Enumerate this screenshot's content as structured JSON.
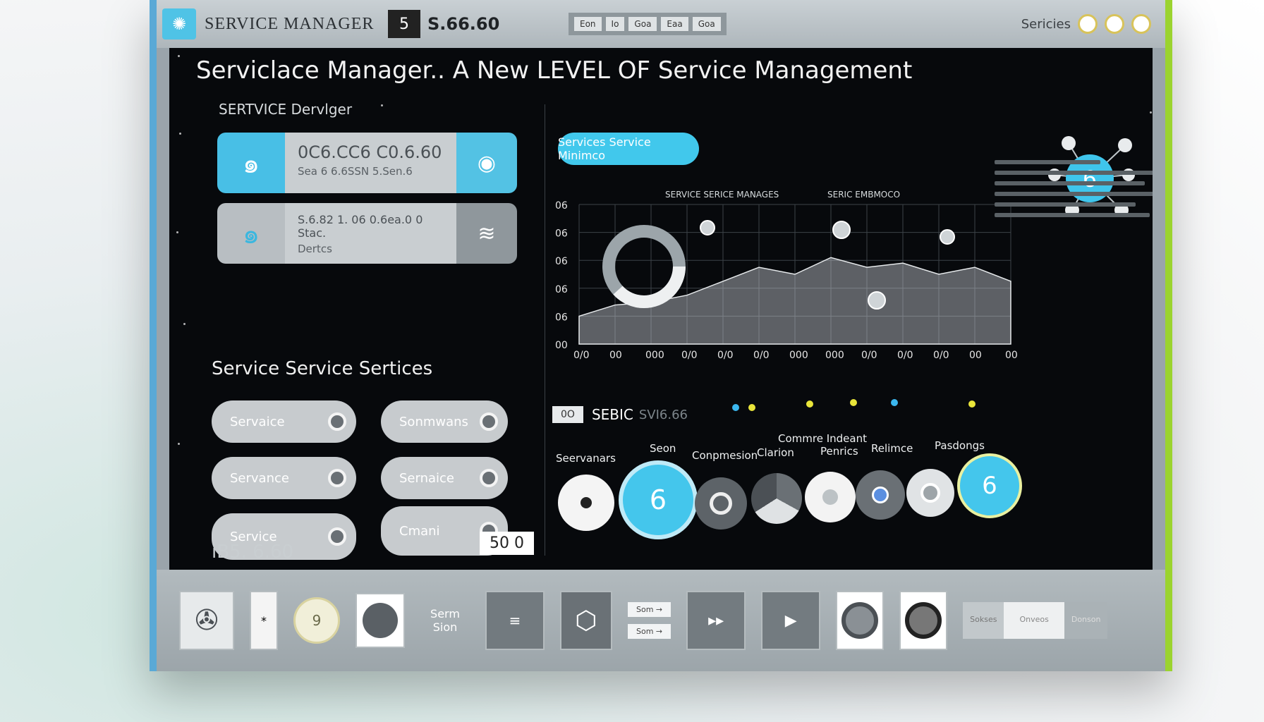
{
  "topbar": {
    "app_title": "SERVICE MANAGER",
    "count": "5",
    "version": "S.66.60",
    "mini_tabs": [
      "Eon",
      "Io",
      "Goa",
      "Eaa",
      "Goa"
    ],
    "right_label": "Sericies"
  },
  "headline": "Serviclace Manager.. A New LEVEL OF Service Management",
  "left_panel": {
    "label": "SERTVICE Dervlger",
    "cards": [
      {
        "main": "0C6.CC6   C0.6.60",
        "sub": "Sea 6   6.6SSN  5.Sen.6"
      },
      {
        "main": "S.6.82  1. 06 0.6ea.0   0 Stac.",
        "sub": "Dertcs"
      }
    ],
    "section_title": "Service Service Sertices",
    "pills": [
      "Servaice",
      "Sonmwans",
      "Servance",
      "Sernaice",
      "Service",
      "Cmani"
    ],
    "mini_count": "50  0",
    "bottom_version": "iB5. 6.60"
  },
  "right_panel": {
    "cta": "Services Service Minimco",
    "chart_title_left": "SERVICE SERICE MANAGES",
    "chart_title_right": "SERIC EMBMOCO",
    "y_ticks": [
      "06",
      "06",
      "06",
      "06",
      "06",
      "00"
    ],
    "x_ticks": [
      "0/0",
      "00",
      "000",
      "0/0",
      "0/0",
      "0/0",
      "000",
      "000",
      "0/0",
      "0/0",
      "0/0",
      "00",
      "00"
    ],
    "service_small": "0O",
    "service_code": "SEBIC",
    "service_code_sub": "SVI6.66",
    "gauge_title": "Commre Indeant",
    "gauges": [
      "Seervanars",
      "Seon",
      "Conpmesion",
      "Clarion",
      "Penrics",
      "Relimce",
      "Pasdongs"
    ],
    "big_number": "6"
  },
  "network": {
    "center_number": "6"
  },
  "bottombar": {
    "btn_star": "*",
    "btn_num": "9",
    "btn_text": "Serm Sion",
    "mini_buttons": [
      "Som →",
      "Som →"
    ],
    "status_segments": [
      "Sokses",
      "Onveos",
      "Donson"
    ]
  },
  "chart_data": {
    "type": "area",
    "title": "",
    "x": [
      0,
      1,
      2,
      3,
      4,
      5,
      6,
      7,
      8,
      9,
      10,
      11,
      12
    ],
    "series": [
      {
        "values": [
          0.2,
          0.28,
          0.3,
          0.35,
          0.45,
          0.55,
          0.5,
          0.62,
          0.55,
          0.58,
          0.5,
          0.55,
          0.45
        ]
      }
    ],
    "xlabel": "",
    "ylabel": "",
    "ylim": [
      0,
      1
    ],
    "grid": true
  }
}
